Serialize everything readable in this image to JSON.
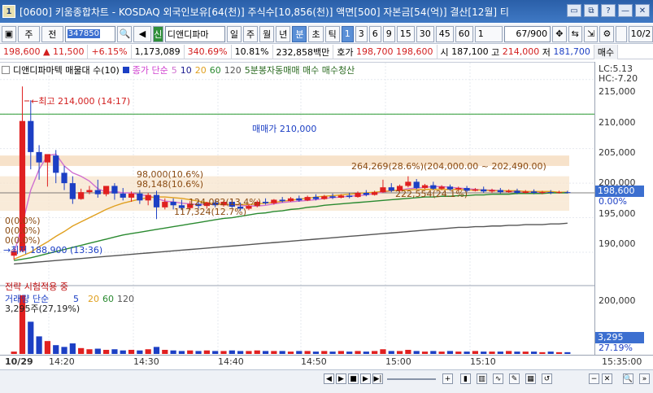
{
  "window": {
    "number": "1",
    "title": "[0600] 키움종합차트 - KOSDAQ 외국인보유[64(천)] 주식수[10,856(천)] 액면[500] 자본금[54(억)] 결산[12월] 티",
    "controls": [
      "▭",
      "⧉",
      "?",
      "—",
      "✕"
    ]
  },
  "toolbar": {
    "market": "주",
    "prev": "전",
    "code": "347850",
    "name_flag": "신",
    "stock_name": "디앤디파마",
    "periods": [
      "일",
      "주",
      "월",
      "년",
      "분",
      "초",
      "틱"
    ],
    "active_period": "분",
    "intervals": [
      "1",
      "3",
      "6",
      "9",
      "15",
      "30",
      "45",
      "60"
    ],
    "active_interval": "1",
    "interval_select": "1",
    "paging": "67/900",
    "date": "10/2"
  },
  "quote": {
    "price": "198,600",
    "arrow": "▲",
    "change": "11,500",
    "change_pct": "+6.15%",
    "volume": "1,173,089",
    "vol_ratio": "340.69%",
    "turnover": "10.81%",
    "amount": "232,858백만",
    "bid_label": "호가",
    "bid": "198,700",
    "ask": "198,600",
    "open_label": "시",
    "open": "187,100",
    "high_label": "고",
    "high": "214,000",
    "low_label": "저",
    "low": "181,700",
    "buy_btn": "매수"
  },
  "legend": {
    "stock_name": "디앤디파마텍 매물대 수(10)",
    "ma_label": "종가 단순",
    "ma_periods": [
      "5",
      "10",
      "20",
      "60",
      "120"
    ],
    "ma_colors": [
      "#d6a0e0",
      "#1a1a90",
      "#e0a020",
      "#2a8a30",
      "#555555"
    ],
    "signal": "5분봉자동매매 매수 매수청산",
    "strategy": "전략 시험적용 중"
  },
  "annotations": {
    "high": "최고 214,000 (14:17)",
    "low": "최저 188,900 (13:36)",
    "target": "매매가 210,000",
    "zone_big": "264,269(28.6%)(204,000.00 ~ 202,490.00)",
    "zone1": "98,000(10.6%)",
    "zone2": "98,148(10.6%)",
    "zone3": "124,082(13.4%)",
    "zone4": "117,324(12.7%)",
    "zone5": "222,554(24.1%)",
    "zero1": "0(0.0%)",
    "zero2": "0(0.0%)",
    "zero3": "0(0.0%)",
    "vol_peak": "3,295주(27,19%)"
  },
  "axis": {
    "lc": "LC:5.13",
    "hc": "HC:-7.20",
    "price_ticks": [
      "215,000",
      "210,000",
      "205,000",
      "200,000",
      "195,000",
      "190,000"
    ],
    "current_price": "198,600",
    "current_pct": "0.00%",
    "vol_ticks": [
      "200,000"
    ],
    "current_vol": "3,295",
    "current_vol_pct": "27.19%"
  },
  "volume_legend": {
    "label": "거래량 단순",
    "periods": [
      "5",
      "20",
      "60",
      "120"
    ]
  },
  "time_axis": {
    "date": "10/29",
    "ticks": [
      "14:20",
      "14:30",
      "14:40",
      "14:50",
      "15:00",
      "15:10",
      "15:35:00"
    ]
  },
  "chart_data": {
    "type": "candlestick",
    "x_unit": "1-minute bars, 10/29",
    "price_ylim": [
      188000,
      216500
    ],
    "candles": [
      {
        "o": 189500,
        "h": 190500,
        "c": 190200,
        "l": 188900
      },
      {
        "o": 190200,
        "h": 214000,
        "c": 209000,
        "l": 190000
      },
      {
        "o": 209000,
        "h": 212000,
        "c": 204500,
        "l": 202000
      },
      {
        "o": 204500,
        "h": 205500,
        "c": 203000,
        "l": 200500
      },
      {
        "o": 203000,
        "h": 204000,
        "c": 204200,
        "l": 199500
      },
      {
        "o": 204000,
        "h": 204800,
        "c": 201500,
        "l": 200000
      },
      {
        "o": 201500,
        "h": 202500,
        "c": 200000,
        "l": 199000
      },
      {
        "o": 200000,
        "h": 201000,
        "c": 197700,
        "l": 197000
      },
      {
        "o": 197700,
        "h": 199200,
        "c": 198700,
        "l": 197600
      },
      {
        "o": 198700,
        "h": 199600,
        "c": 199000,
        "l": 198400
      },
      {
        "o": 199000,
        "h": 200500,
        "c": 198400,
        "l": 197900
      },
      {
        "o": 198400,
        "h": 199500,
        "c": 199600,
        "l": 198100
      },
      {
        "o": 199600,
        "h": 200000,
        "c": 198500,
        "l": 197600
      },
      {
        "o": 198500,
        "h": 199300,
        "c": 197900,
        "l": 197500
      },
      {
        "o": 197900,
        "h": 198800,
        "c": 198500,
        "l": 197300
      },
      {
        "o": 198500,
        "h": 199000,
        "c": 197500,
        "l": 197000
      },
      {
        "o": 197500,
        "h": 198600,
        "c": 198300,
        "l": 196800
      },
      {
        "o": 198300,
        "h": 198900,
        "c": 196500,
        "l": 194800
      },
      {
        "o": 196500,
        "h": 197800,
        "c": 197300,
        "l": 196200
      },
      {
        "o": 197300,
        "h": 197800,
        "c": 196800,
        "l": 196200
      },
      {
        "o": 196800,
        "h": 197600,
        "c": 196400,
        "l": 196100
      },
      {
        "o": 196400,
        "h": 197400,
        "c": 197000,
        "l": 196100
      },
      {
        "o": 197000,
        "h": 197600,
        "c": 196700,
        "l": 196300
      },
      {
        "o": 196700,
        "h": 197300,
        "c": 197200,
        "l": 196300
      },
      {
        "o": 197200,
        "h": 197600,
        "c": 196800,
        "l": 196500
      },
      {
        "o": 196800,
        "h": 197500,
        "c": 197300,
        "l": 196600
      },
      {
        "o": 197300,
        "h": 197700,
        "c": 196600,
        "l": 196400
      },
      {
        "o": 196600,
        "h": 197200,
        "c": 196300,
        "l": 196000
      },
      {
        "o": 196300,
        "h": 197000,
        "c": 196700,
        "l": 196100
      },
      {
        "o": 196700,
        "h": 197500,
        "c": 197300,
        "l": 196500
      },
      {
        "o": 197300,
        "h": 197800,
        "c": 197100,
        "l": 196900
      },
      {
        "o": 197100,
        "h": 197700,
        "c": 197600,
        "l": 196900
      },
      {
        "o": 197600,
        "h": 198000,
        "c": 197400,
        "l": 197200
      },
      {
        "o": 197400,
        "h": 198000,
        "c": 197800,
        "l": 197300
      },
      {
        "o": 197800,
        "h": 198200,
        "c": 197500,
        "l": 197300
      },
      {
        "o": 197500,
        "h": 198200,
        "c": 198000,
        "l": 197400
      },
      {
        "o": 198000,
        "h": 198400,
        "c": 197700,
        "l": 197500
      },
      {
        "o": 197700,
        "h": 198300,
        "c": 198100,
        "l": 197600
      },
      {
        "o": 198100,
        "h": 198500,
        "c": 197900,
        "l": 197700
      },
      {
        "o": 197900,
        "h": 198400,
        "c": 198200,
        "l": 197800
      },
      {
        "o": 198200,
        "h": 198600,
        "c": 198000,
        "l": 197800
      },
      {
        "o": 198000,
        "h": 198800,
        "c": 198600,
        "l": 197900
      },
      {
        "o": 198600,
        "h": 199000,
        "c": 198300,
        "l": 198100
      },
      {
        "o": 198300,
        "h": 198900,
        "c": 198700,
        "l": 198200
      },
      {
        "o": 198700,
        "h": 200500,
        "c": 199400,
        "l": 198600
      },
      {
        "o": 199400,
        "h": 200000,
        "c": 198900,
        "l": 198700
      },
      {
        "o": 198900,
        "h": 199800,
        "c": 199600,
        "l": 198800
      },
      {
        "o": 199600,
        "h": 201000,
        "c": 200200,
        "l": 199400
      },
      {
        "o": 200200,
        "h": 200600,
        "c": 199300,
        "l": 199100
      },
      {
        "o": 199300,
        "h": 199900,
        "c": 199700,
        "l": 199100
      },
      {
        "o": 199700,
        "h": 200200,
        "c": 199200,
        "l": 199000
      },
      {
        "o": 199200,
        "h": 199700,
        "c": 199500,
        "l": 199000
      },
      {
        "o": 199500,
        "h": 199800,
        "c": 199100,
        "l": 198900
      },
      {
        "o": 199100,
        "h": 199500,
        "c": 199300,
        "l": 198900
      },
      {
        "o": 199300,
        "h": 199600,
        "c": 198900,
        "l": 198700
      },
      {
        "o": 198900,
        "h": 199300,
        "c": 199100,
        "l": 198800
      },
      {
        "o": 199100,
        "h": 199500,
        "c": 198800,
        "l": 198600
      },
      {
        "o": 198800,
        "h": 199200,
        "c": 199000,
        "l": 198600
      },
      {
        "o": 199000,
        "h": 199300,
        "c": 198700,
        "l": 198500
      },
      {
        "o": 198700,
        "h": 199100,
        "c": 198900,
        "l": 198600
      },
      {
        "o": 198900,
        "h": 199200,
        "c": 198600,
        "l": 198400
      },
      {
        "o": 198600,
        "h": 199000,
        "c": 198800,
        "l": 198500
      },
      {
        "o": 198800,
        "h": 199100,
        "c": 198600,
        "l": 198400
      },
      {
        "o": 198600,
        "h": 198900,
        "c": 198700,
        "l": 198400
      },
      {
        "o": 198700,
        "h": 199000,
        "c": 198600,
        "l": 198400
      },
      {
        "o": 198600,
        "h": 198900,
        "c": 198700,
        "l": 198500
      },
      {
        "o": 198700,
        "h": 198900,
        "c": 198600,
        "l": 198500
      }
    ],
    "ma_lines": [
      {
        "name": "5",
        "color": "#d070d0",
        "values": [
          189800,
          194000,
          199000,
          202000,
          204000,
          204200,
          202500,
          201500,
          201000,
          200300,
          199200,
          198700,
          198800,
          198600,
          198600,
          198300,
          198200,
          197800,
          197400,
          197300,
          197100,
          197000,
          196900,
          196900,
          197000,
          196900,
          196900,
          196800,
          196700,
          196700,
          196800,
          197000,
          197200,
          197300,
          197400,
          197500,
          197600,
          197800,
          197900,
          198000,
          198100,
          198200,
          198300,
          198500,
          198700,
          198900,
          199000,
          199200,
          199300,
          199400,
          199500,
          199500,
          199400,
          199300,
          199200,
          199100,
          199000,
          199000,
          198900,
          198800,
          198800,
          198700,
          198700,
          198700,
          198700,
          198700,
          198700
        ]
      },
      {
        "name": "20",
        "color": "#e0a020",
        "values": [
          189000,
          189500,
          190000,
          190800,
          191500,
          192300,
          193000,
          193800,
          194400,
          195000,
          195600,
          196200,
          196700,
          197100,
          197400,
          197700,
          197900,
          198000,
          198000,
          197900,
          197800,
          197600,
          197400,
          197200,
          197000,
          196900,
          196900,
          196900,
          196900,
          197000,
          197100,
          197200,
          197400,
          197500,
          197700,
          197800,
          198000,
          198100,
          198200,
          198300,
          198400,
          198500,
          198600,
          198700,
          198800,
          198900,
          199000,
          199000,
          199100,
          199100,
          199100,
          199100,
          199100,
          199100,
          199000,
          199000,
          199000,
          198900,
          198900,
          198900,
          198900,
          198800,
          198800,
          198800,
          198800,
          198700,
          198700
        ]
      },
      {
        "name": "60",
        "color": "#2a8a30",
        "values": [
          188800,
          189000,
          189200,
          189500,
          189800,
          190100,
          190400,
          190700,
          191000,
          191300,
          191600,
          191900,
          192200,
          192500,
          192700,
          192900,
          193100,
          193300,
          193500,
          193700,
          193900,
          194100,
          194300,
          194500,
          194700,
          194900,
          195000,
          195200,
          195400,
          195600,
          195700,
          195900,
          196000,
          196200,
          196300,
          196500,
          196600,
          196800,
          196900,
          197000,
          197100,
          197200,
          197300,
          197400,
          197500,
          197600,
          197700,
          197800,
          197900,
          198000,
          198000,
          198100,
          198100,
          198200,
          198200,
          198300,
          198300,
          198400,
          198400,
          198400,
          198500,
          198500,
          198500,
          198500,
          198600,
          198600,
          198600
        ]
      },
      {
        "name": "120",
        "color": "#555555",
        "values": [
          188300,
          188400,
          188500,
          188600,
          188700,
          188800,
          188900,
          189000,
          189100,
          189200,
          189300,
          189400,
          189500,
          189600,
          189700,
          189800,
          189900,
          190000,
          190100,
          190200,
          190300,
          190400,
          190500,
          190600,
          190700,
          190800,
          190900,
          191000,
          191100,
          191200,
          191300,
          191400,
          191500,
          191600,
          191700,
          191800,
          191900,
          192000,
          192100,
          192200,
          192300,
          192400,
          192500,
          192600,
          192700,
          192800,
          192900,
          193000,
          193100,
          193200,
          193300,
          193400,
          193500,
          193600,
          193600,
          193700,
          193700,
          193800,
          193800,
          193900,
          193900,
          194000,
          194000,
          194000,
          194100,
          194100,
          194200
        ]
      }
    ],
    "horizontal_lines": [
      {
        "value": 210000,
        "color": "#2a9a30"
      }
    ],
    "volume": [
      0.04,
      1.0,
      0.55,
      0.3,
      0.22,
      0.15,
      0.12,
      0.18,
      0.1,
      0.08,
      0.09,
      0.07,
      0.08,
      0.06,
      0.07,
      0.06,
      0.08,
      0.12,
      0.07,
      0.06,
      0.05,
      0.06,
      0.05,
      0.06,
      0.05,
      0.05,
      0.06,
      0.05,
      0.05,
      0.06,
      0.05,
      0.05,
      0.05,
      0.04,
      0.05,
      0.05,
      0.04,
      0.05,
      0.04,
      0.05,
      0.04,
      0.05,
      0.04,
      0.05,
      0.08,
      0.05,
      0.05,
      0.07,
      0.05,
      0.04,
      0.05,
      0.04,
      0.05,
      0.04,
      0.04,
      0.05,
      0.04,
      0.04,
      0.04,
      0.05,
      0.04,
      0.04,
      0.04,
      0.03,
      0.04,
      0.03,
      0.03
    ],
    "volume_ylim": [
      0,
      200000
    ]
  }
}
